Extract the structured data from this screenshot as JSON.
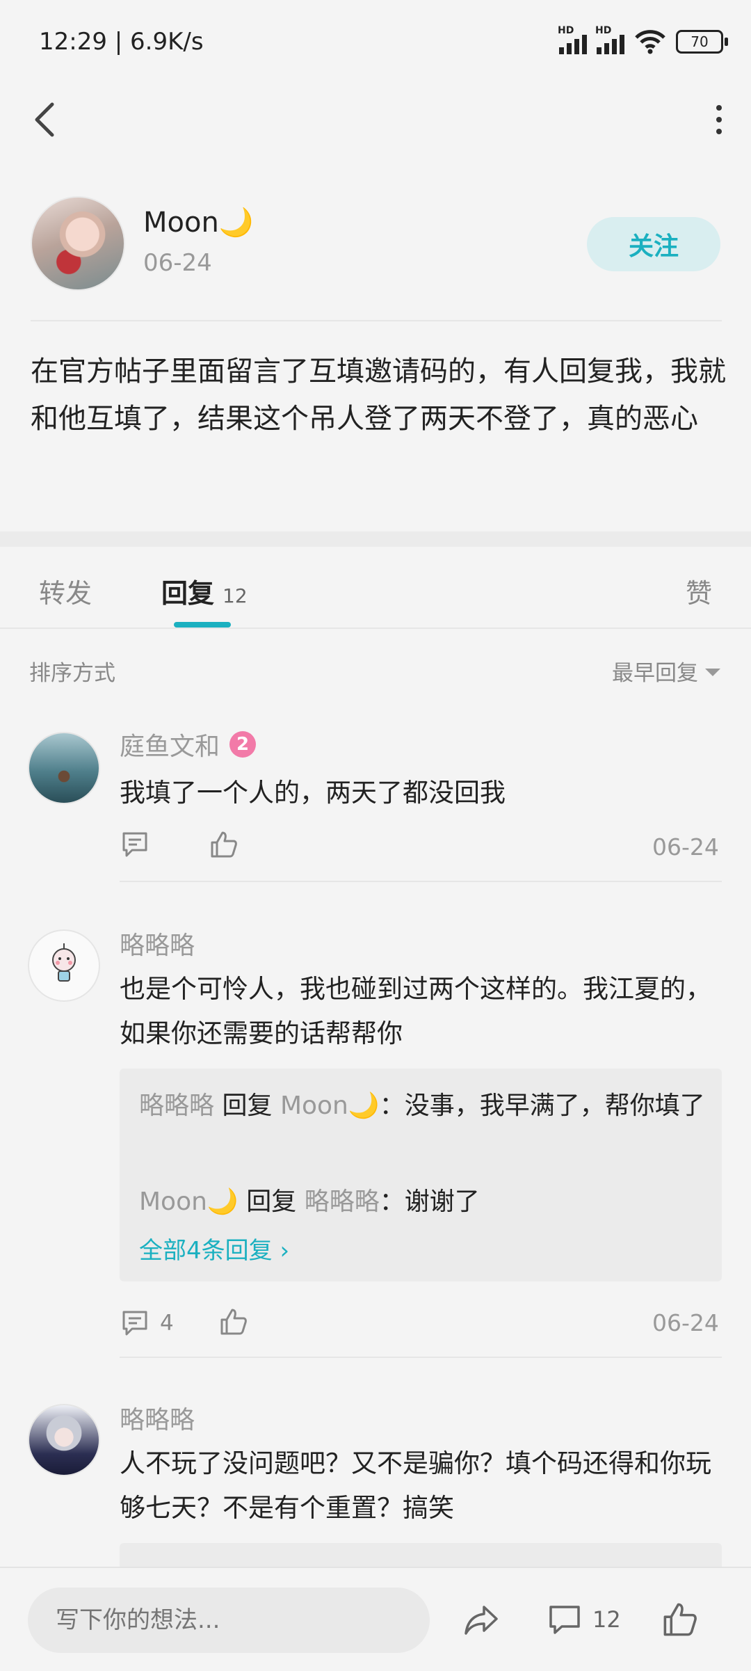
{
  "status_bar": {
    "time": "12:29 | 6.9K/s",
    "hd1": "HD",
    "hd2": "HD",
    "battery": "70"
  },
  "post": {
    "author": "Moon🌙",
    "date": "06-24",
    "follow_label": "关注",
    "content": "在官方帖子里面留言了互填邀请码的，有人回复我，我就和他互填了，结果这个吊人登了两天不登了，真的恶心"
  },
  "tabs": {
    "repost": "转发",
    "reply": "回复",
    "reply_count": "12",
    "like": "赞"
  },
  "sort": {
    "label": "排序方式",
    "value": "最早回复"
  },
  "comments": [
    {
      "name": "庭鱼文和",
      "badge": "2",
      "text": "我填了一个人的，两天了都没回我",
      "date": "06-24"
    },
    {
      "name": "略略略",
      "text": "也是个可怜人，我也碰到过两个这样的。我江夏的，如果你还需要的话帮帮你",
      "comment_count": "4",
      "date": "06-24",
      "replies": [
        {
          "from": "略略略",
          "verb": "回复",
          "to": "Moon🌙",
          "text": "：没事，我早满了，帮你填了"
        },
        {
          "from": "Moon🌙",
          "verb": "回复",
          "to": "略略略",
          "text": "：谢谢了"
        }
      ],
      "more_replies": "全部4条回复 ›"
    },
    {
      "name": "略略略",
      "text": "人不玩了没问题吧？又不是骗你？填个码还得和你玩够七天？不是有个重置？搞笑"
    }
  ],
  "bottom_bar": {
    "placeholder": "写下你的想法...",
    "comment_count": "12"
  },
  "colors": {
    "accent": "#1bb0c0",
    "badge": "#f27aa8",
    "follow_bg": "#d9eef0"
  }
}
